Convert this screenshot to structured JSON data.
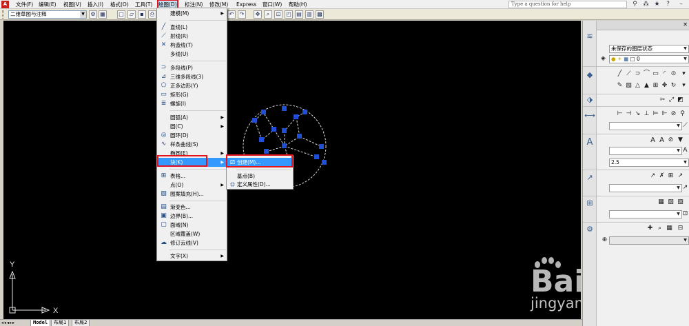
{
  "menubar": {
    "items": [
      {
        "label": "文件(F)"
      },
      {
        "label": "编辑(E)"
      },
      {
        "label": "视图(V)"
      },
      {
        "label": "插入(I)"
      },
      {
        "label": "格式(O)"
      },
      {
        "label": "工具(T)"
      },
      {
        "label": "绘图(D)"
      },
      {
        "label": "标注(N)"
      },
      {
        "label": "修改(M)"
      },
      {
        "label": "Express"
      },
      {
        "label": "窗口(W)"
      },
      {
        "label": "帮助(H)"
      }
    ],
    "help_search_placeholder": "Type a question for help"
  },
  "toolbar": {
    "workspace": "二维草图与注释"
  },
  "draw_menu": {
    "items": [
      {
        "label": "建模(M)",
        "icon": "none",
        "submenu": true
      },
      {
        "label": "直线(L)",
        "icon": "line-icon"
      },
      {
        "label": "射线(R)",
        "icon": "ray-icon"
      },
      {
        "label": "构造线(T)",
        "icon": "xline-icon"
      },
      {
        "label": "多线(U)",
        "icon": "none"
      },
      {
        "label": "多段线(P)",
        "icon": "polyline-icon"
      },
      {
        "label": "三维多段线(3)",
        "icon": "3dpoly-icon"
      },
      {
        "label": "正多边形(Y)",
        "icon": "polygon-icon"
      },
      {
        "label": "矩形(G)",
        "icon": "rectangle-icon"
      },
      {
        "label": "螺旋(I)",
        "icon": "helix-icon"
      },
      {
        "label": "圆弧(A)",
        "icon": "none",
        "submenu": true
      },
      {
        "label": "圆(C)",
        "icon": "none",
        "submenu": true
      },
      {
        "label": "圆环(D)",
        "icon": "donut-icon"
      },
      {
        "label": "样条曲线(S)",
        "icon": "spline-icon"
      },
      {
        "label": "椭圆(E)",
        "icon": "none",
        "submenu": true
      },
      {
        "label": "块(K)",
        "icon": "none",
        "submenu": true
      },
      {
        "label": "表格...",
        "icon": "table-icon"
      },
      {
        "label": "点(O)",
        "icon": "none",
        "submenu": true
      },
      {
        "label": "图案填充(H)...",
        "icon": "hatch-icon"
      },
      {
        "label": "渐变色...",
        "icon": "gradient-icon"
      },
      {
        "label": "边界(B)...",
        "icon": "boundary-icon"
      },
      {
        "label": "面域(N)",
        "icon": "region-icon"
      },
      {
        "label": "区域覆盖(W)",
        "icon": "none"
      },
      {
        "label": "修订云线(V)",
        "icon": "revcloud-icon"
      },
      {
        "label": "文字(X)",
        "icon": "none",
        "submenu": true
      }
    ]
  },
  "block_submenu": {
    "items": [
      {
        "label": "创建(M)...",
        "icon": "block-create-icon"
      },
      {
        "label": "基点(B)",
        "icon": "none"
      },
      {
        "label": "定义属性(D)...",
        "icon": "attdef-icon"
      }
    ]
  },
  "palette": {
    "layer_state": "未保存的图层状态",
    "layer_current": "0",
    "text_height": "2.5"
  },
  "layout_tabs": [
    "Model",
    "布局1",
    "布局2"
  ],
  "ucs": {
    "x_label": "X",
    "y_label": "Y"
  },
  "watermark": {
    "brand": "Bai  经验",
    "url": "jingyan.baidu.com"
  },
  "colors": {
    "menu_highlight": "#3399ff",
    "callout_red": "#e2141f",
    "canvas_bg": "#000000",
    "grip_blue": "#1f4fd8"
  }
}
